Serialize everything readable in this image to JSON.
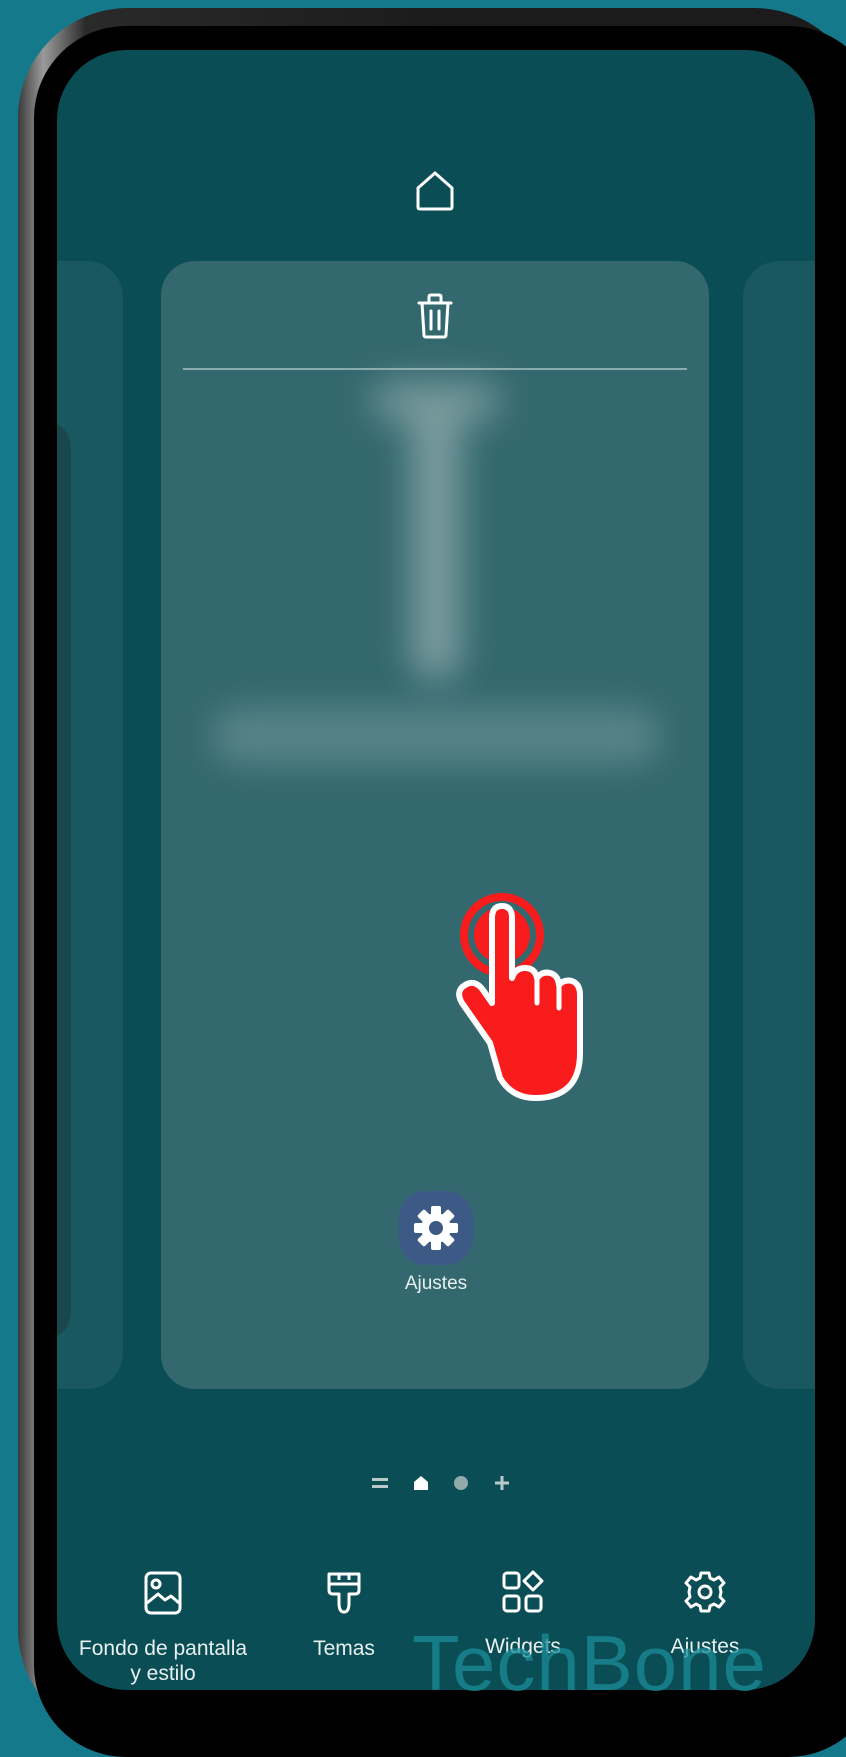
{
  "home_screen_editor": {
    "current_page_app": {
      "label": "Ajustes",
      "icon": "settings-gear-icon"
    },
    "page_indicator": [
      "lines-icon",
      "home-dot-icon",
      "page-dot-icon",
      "add-page-icon"
    ],
    "toolbar": [
      {
        "label": "Fondo de pantalla y estilo",
        "icon": "wallpaper-icon"
      },
      {
        "label": "Temas",
        "icon": "paintbrush-icon"
      },
      {
        "label": "Widgets",
        "icon": "widgets-icon"
      },
      {
        "label": "Ajustes",
        "icon": "gear-icon"
      }
    ]
  },
  "overlay": {
    "watermark": "TechBone",
    "tap_color": "#f91c1c"
  },
  "colors": {
    "background": "#14798a",
    "screen": "#0a4d54",
    "page_panel": "#33686e",
    "app_tile": "#3d5a87"
  }
}
